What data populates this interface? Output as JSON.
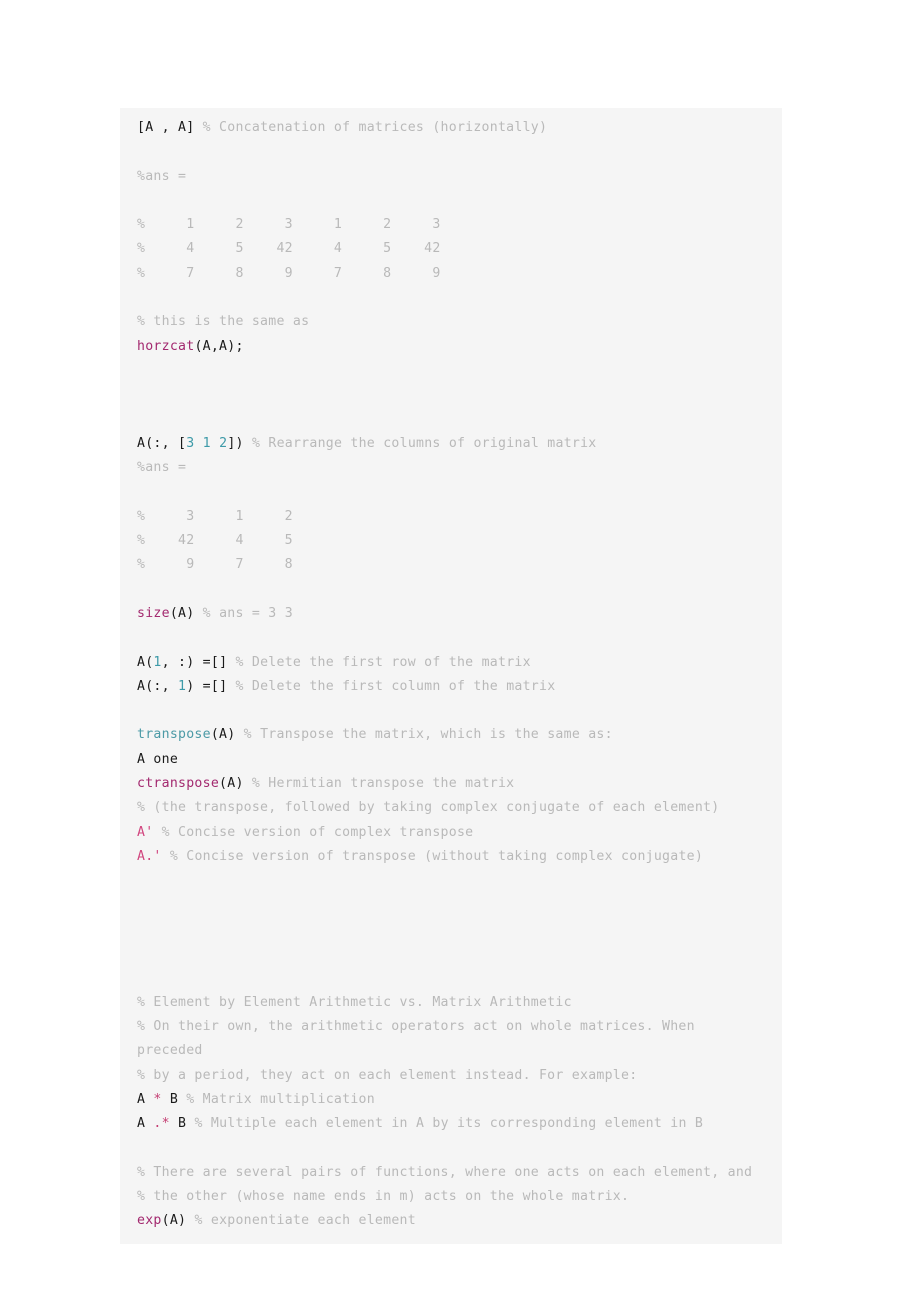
{
  "page": {
    "background_color": "#ffffff",
    "block_background_color": "#f5f5f5",
    "language": "matlab"
  },
  "colors": {
    "plain": "#1a1a1a",
    "comment": "#b9b9b9",
    "function": "#a3296f",
    "function_alt": "#4c9aa6",
    "number": "#3d9aa8",
    "string": "#d1467f",
    "operator": "#c43d72"
  },
  "code": {
    "lines": [
      {
        "id": "line-1",
        "tokens": [
          {
            "text": "[A , A] ",
            "type": "plain"
          },
          {
            "text": "% Concatenation of matrices (horizontally)",
            "type": "comment"
          }
        ]
      },
      {
        "id": "line-2",
        "tokens": []
      },
      {
        "id": "line-3",
        "tokens": [
          {
            "text": "%ans =",
            "type": "comment"
          }
        ]
      },
      {
        "id": "line-4",
        "tokens": []
      },
      {
        "id": "line-5",
        "tokens": [
          {
            "text": "%     1     2     3     1     2     3",
            "type": "comment"
          }
        ]
      },
      {
        "id": "line-6",
        "tokens": [
          {
            "text": "%     4     5    42     4     5    42",
            "type": "comment"
          }
        ]
      },
      {
        "id": "line-7",
        "tokens": [
          {
            "text": "%     7     8     9     7     8     9",
            "type": "comment"
          }
        ]
      },
      {
        "id": "line-8",
        "tokens": []
      },
      {
        "id": "line-9",
        "tokens": [
          {
            "text": "% this is the same as",
            "type": "comment"
          }
        ]
      },
      {
        "id": "line-10",
        "tokens": [
          {
            "text": "horzcat",
            "type": "function"
          },
          {
            "text": "(A,A);",
            "type": "plain"
          }
        ]
      },
      {
        "id": "line-11",
        "tokens": []
      },
      {
        "id": "line-12",
        "tokens": []
      },
      {
        "id": "line-13",
        "tokens": []
      },
      {
        "id": "line-14",
        "tokens": [
          {
            "text": "A(:, [",
            "type": "plain"
          },
          {
            "text": "3",
            "type": "number"
          },
          {
            "text": " ",
            "type": "plain"
          },
          {
            "text": "1",
            "type": "number"
          },
          {
            "text": " ",
            "type": "plain"
          },
          {
            "text": "2",
            "type": "number"
          },
          {
            "text": "]) ",
            "type": "plain"
          },
          {
            "text": "% Rearrange the columns of original matrix",
            "type": "comment"
          }
        ]
      },
      {
        "id": "line-15",
        "tokens": [
          {
            "text": "%ans =",
            "type": "comment"
          }
        ]
      },
      {
        "id": "line-16",
        "tokens": []
      },
      {
        "id": "line-17",
        "tokens": [
          {
            "text": "%     3     1     2",
            "type": "comment"
          }
        ]
      },
      {
        "id": "line-18",
        "tokens": [
          {
            "text": "%    42     4     5",
            "type": "comment"
          }
        ]
      },
      {
        "id": "line-19",
        "tokens": [
          {
            "text": "%     9     7     8",
            "type": "comment"
          }
        ]
      },
      {
        "id": "line-20",
        "tokens": []
      },
      {
        "id": "line-21",
        "tokens": [
          {
            "text": "size",
            "type": "function"
          },
          {
            "text": "(A) ",
            "type": "plain"
          },
          {
            "text": "% ans = 3 3",
            "type": "comment"
          }
        ]
      },
      {
        "id": "line-22",
        "tokens": []
      },
      {
        "id": "line-23",
        "tokens": [
          {
            "text": "A(",
            "type": "plain"
          },
          {
            "text": "1",
            "type": "number"
          },
          {
            "text": ", :) =[] ",
            "type": "plain"
          },
          {
            "text": "% Delete the first row of the matrix",
            "type": "comment"
          }
        ]
      },
      {
        "id": "line-24",
        "tokens": [
          {
            "text": "A(:, ",
            "type": "plain"
          },
          {
            "text": "1",
            "type": "number"
          },
          {
            "text": ") =[] ",
            "type": "plain"
          },
          {
            "text": "% Delete the first column of the matrix",
            "type": "comment"
          }
        ]
      },
      {
        "id": "line-25",
        "tokens": []
      },
      {
        "id": "line-26",
        "tokens": [
          {
            "text": "transpose",
            "type": "function_alt"
          },
          {
            "text": "(A) ",
            "type": "plain"
          },
          {
            "text": "% Transpose the matrix, which is the same as:",
            "type": "comment"
          }
        ]
      },
      {
        "id": "line-27",
        "tokens": [
          {
            "text": "A one",
            "type": "plain"
          }
        ]
      },
      {
        "id": "line-28",
        "tokens": [
          {
            "text": "ctranspose",
            "type": "function"
          },
          {
            "text": "(A) ",
            "type": "plain"
          },
          {
            "text": "% Hermitian transpose the matrix",
            "type": "comment"
          }
        ]
      },
      {
        "id": "line-29",
        "tokens": [
          {
            "text": "% (the transpose, followed by taking complex conjugate of each element)",
            "type": "comment"
          }
        ]
      },
      {
        "id": "line-30",
        "tokens": [
          {
            "text": "A'",
            "type": "string"
          },
          {
            "text": " ",
            "type": "plain"
          },
          {
            "text": "% Concise version of complex transpose",
            "type": "comment"
          }
        ]
      },
      {
        "id": "line-31",
        "tokens": [
          {
            "text": "A.'",
            "type": "string"
          },
          {
            "text": " ",
            "type": "plain"
          },
          {
            "text": "% Concise version of transpose (without taking complex conjugate)",
            "type": "comment"
          }
        ]
      },
      {
        "id": "line-32",
        "tokens": []
      },
      {
        "id": "line-33",
        "tokens": []
      },
      {
        "id": "line-34",
        "tokens": []
      },
      {
        "id": "line-35",
        "tokens": []
      },
      {
        "id": "line-36",
        "tokens": []
      },
      {
        "id": "line-37",
        "tokens": [
          {
            "text": "% Element by Element Arithmetic vs. Matrix Arithmetic",
            "type": "comment"
          }
        ]
      },
      {
        "id": "line-38",
        "tokens": [
          {
            "text": "% On their own, the arithmetic operators act on whole matrices. When",
            "type": "comment"
          }
        ]
      },
      {
        "id": "line-39",
        "tokens": [
          {
            "text": "preceded",
            "type": "comment"
          }
        ]
      },
      {
        "id": "line-40",
        "tokens": [
          {
            "text": "% by a period, they act on each element instead. For example:",
            "type": "comment"
          }
        ]
      },
      {
        "id": "line-41",
        "tokens": [
          {
            "text": "A ",
            "type": "plain"
          },
          {
            "text": "*",
            "type": "operator"
          },
          {
            "text": " B ",
            "type": "plain"
          },
          {
            "text": "% Matrix multiplication",
            "type": "comment"
          }
        ]
      },
      {
        "id": "line-42",
        "tokens": [
          {
            "text": "A ",
            "type": "plain"
          },
          {
            "text": ".*",
            "type": "operator"
          },
          {
            "text": " B ",
            "type": "plain"
          },
          {
            "text": "% Multiple each element in A by its corresponding element in B",
            "type": "comment"
          }
        ]
      },
      {
        "id": "line-43",
        "tokens": []
      },
      {
        "id": "line-44",
        "tokens": [
          {
            "text": "% There are several pairs of functions, where one acts on each element, and",
            "type": "comment"
          }
        ]
      },
      {
        "id": "line-45",
        "tokens": [
          {
            "text": "% the other (whose name ends in m) acts on the whole matrix.",
            "type": "comment"
          }
        ]
      },
      {
        "id": "line-46",
        "tokens": [
          {
            "text": "exp",
            "type": "function"
          },
          {
            "text": "(A) ",
            "type": "plain"
          },
          {
            "text": "% exponentiate each element",
            "type": "comment"
          }
        ]
      }
    ]
  }
}
